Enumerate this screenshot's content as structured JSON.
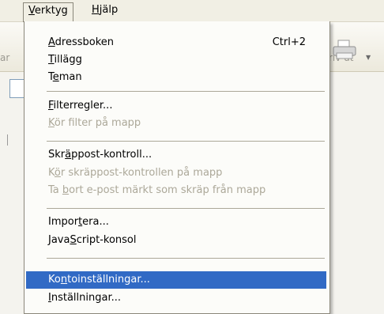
{
  "menubar": {
    "items": [
      {
        "prefix": "",
        "u": "V",
        "rest": "erktyg"
      },
      {
        "prefix": "",
        "u": "H",
        "rest": "jälp"
      }
    ]
  },
  "toolbar": {
    "left_cut_label": "ar",
    "print_label": "riv ut"
  },
  "menu": {
    "items": [
      {
        "prefix": "",
        "u": "A",
        "rest": "dressboken",
        "shortcut": "Ctrl+2"
      },
      {
        "prefix": "",
        "u": "T",
        "rest": "illägg"
      },
      {
        "prefix": "T",
        "u": "e",
        "rest": "man"
      },
      {
        "prefix": "",
        "u": "F",
        "rest": "ilterregler..."
      },
      {
        "prefix": "",
        "u": "K",
        "rest": "ör filter på mapp"
      },
      {
        "prefix": "Skr",
        "u": "ä",
        "rest": "ppost-kontroll..."
      },
      {
        "prefix": "K",
        "u": "ö",
        "rest": "r skräppost-kontrollen på mapp"
      },
      {
        "prefix": "Ta ",
        "u": "b",
        "rest": "ort e-post märkt som skräp från mapp"
      },
      {
        "prefix": "Impor",
        "u": "t",
        "rest": "era..."
      },
      {
        "prefix": "Java",
        "u": "S",
        "rest": "cript-konsol"
      },
      {
        "prefix": "Ko",
        "u": "n",
        "rest": "toinställningar..."
      },
      {
        "prefix": "",
        "u": "I",
        "rest": "nställningar..."
      }
    ]
  }
}
